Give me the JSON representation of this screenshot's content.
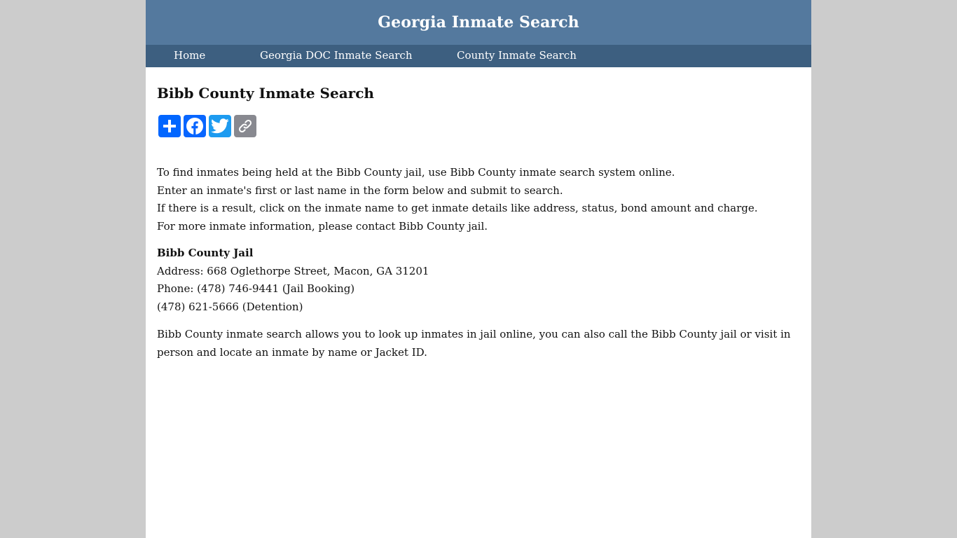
{
  "header": {
    "title": "Georgia Inmate Search"
  },
  "nav": {
    "items": [
      {
        "label": "Home"
      },
      {
        "label": "Georgia DOC Inmate Search"
      },
      {
        "label": "County Inmate Search"
      }
    ]
  },
  "main": {
    "heading": "Bibb County Inmate Search",
    "share": [
      {
        "icon": "plus-share-icon",
        "color": "#0166ff"
      },
      {
        "icon": "facebook-icon",
        "color": "#0866ff"
      },
      {
        "icon": "twitter-icon",
        "color": "#1d9bf0"
      },
      {
        "icon": "copy-link-icon",
        "color": "#888990"
      }
    ],
    "intro_lines": [
      "To find inmates being held at the Bibb County jail, use Bibb County inmate search system online.",
      "Enter an inmate's first or last name in the form below and submit to search.",
      "If there is a result, click on the inmate name to get inmate details like address, status, bond amount and charge.",
      "For more inmate information, please contact Bibb County jail."
    ],
    "jail": {
      "name": "Bibb County Jail",
      "address": "Address: 668 Oglethorpe Street, Macon, GA 31201",
      "phone_booking": "Phone: (478) 746-9441 (Jail Booking)",
      "phone_detention": "(478) 621-5666 (Detention)"
    },
    "outro": "Bibb County inmate search allows you to look up inmates in jail online, you can also call the Bibb County jail or visit in person and locate an inmate by name or Jacket ID."
  },
  "colors": {
    "header_bg": "#54799e",
    "nav_bg": "#3d5f80",
    "page_bg": "#cccccc"
  }
}
